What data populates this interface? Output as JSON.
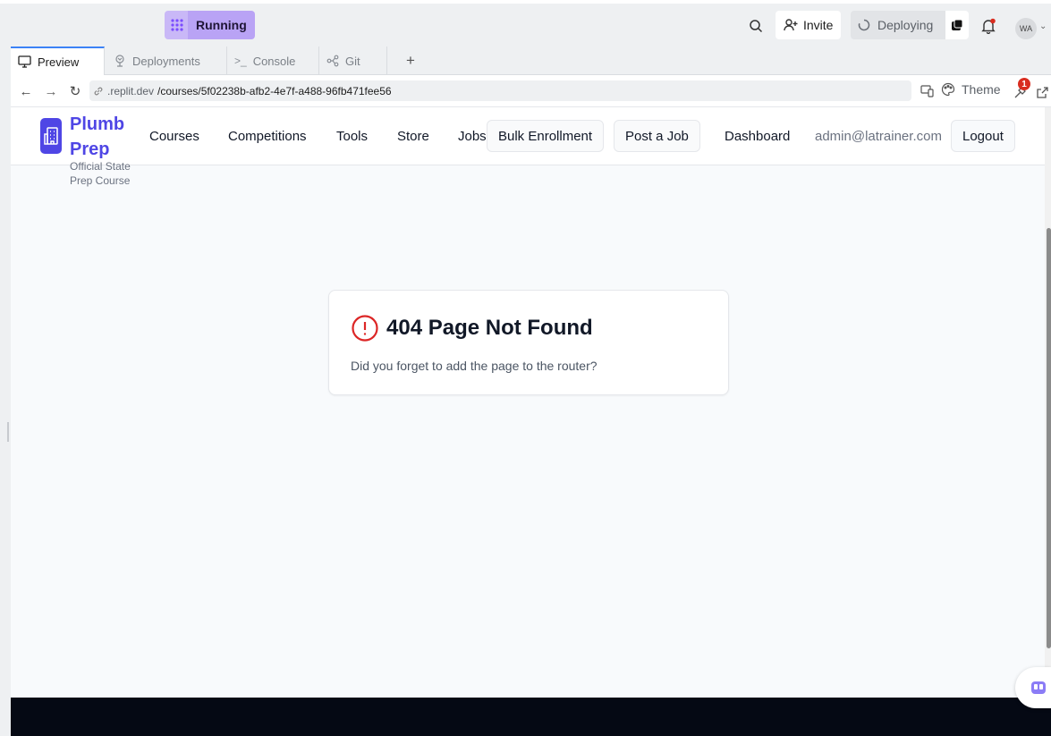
{
  "topbar": {
    "run_label": "Running",
    "invite_label": "Invite",
    "deploy_label": "Deploying",
    "avatar_initials": "WA"
  },
  "tabs": [
    {
      "label": "Preview",
      "icon": "monitor-icon"
    },
    {
      "label": "Deployments",
      "icon": "deploy-icon"
    },
    {
      "label": "Console",
      "icon": "terminal-icon"
    },
    {
      "label": "Git",
      "icon": "git-icon"
    }
  ],
  "browser": {
    "url_host": ".replit.dev",
    "url_path": "/courses/5f02238b-afb2-4e7f-a488-96fb471fee56",
    "theme_label": "Theme",
    "badge_count": "1"
  },
  "site": {
    "brand": "Plumb Prep",
    "tagline": "Official State Prep Course",
    "nav": [
      "Courses",
      "Competitions",
      "Tools",
      "Store",
      "Jobs"
    ],
    "bulk_label": "Bulk Enrollment",
    "post_job_label": "Post a Job",
    "dashboard_label": "Dashboard",
    "email": "admin@latrainer.com",
    "logout_label": "Logout"
  },
  "error": {
    "title": "404 Page Not Found",
    "message": "Did you forget to add the page to the router?"
  },
  "colors": {
    "accent": "#4f46e5",
    "run": "#b9a3f5",
    "error": "#dc2626",
    "footer": "#050914"
  }
}
